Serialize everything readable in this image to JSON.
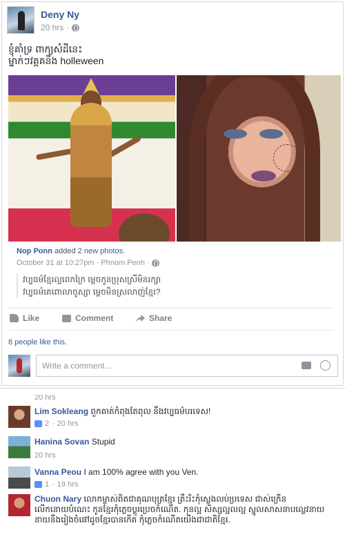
{
  "post": {
    "author": "Deny Ny",
    "time": "20 hrs",
    "text_line1": "ខ្ញុំគាំទ្រ ពាក្យសំដីនេះ",
    "text_line2": "ម្នាក់ៗវគ្គគនឹង holleween"
  },
  "shared": {
    "who": "Nop Ponn",
    "action": "added",
    "count": "2 new photos.",
    "time": "October 31 at 10:27pm · Phnom Penh ·",
    "quote_line1": "វប្បធម៌ខ្មែរល្អពេកក្រៃ ម្ដេចកូនប្រុសស្រីមិនរក្សា",
    "quote_line2": "វប្បធម៌គេពោលាចូស្សា ម្ដេចមិនស្រលាញ់ខ្មែរ?"
  },
  "actions": {
    "like": "Like",
    "comment": "Comment",
    "share": "Share"
  },
  "likes_summary": "8 people like this.",
  "comment_placeholder": "Write a comment...",
  "cut_text": "20 hrs",
  "comments": [
    {
      "name": "Lim Sokleang",
      "text": "ពួកគាត់កំពុងតែពុល នឹងវប្បធម៌បរទេស!",
      "likes": "2",
      "time": "20 hrs"
    },
    {
      "name": "Hanina Sovan",
      "text": "Stupid",
      "likes": "",
      "time": "20 hrs"
    },
    {
      "name": "Vanna Peou",
      "text": "I am 100% agree with you Ven.",
      "likes": "1",
      "time": "19 hrs"
    },
    {
      "name": "Chuon Nary",
      "text": "លោកម្ចាស់ពិតជាគុណបុត្រខ្មែរ ត្រឹះរិះកុំស្លេងលប់ប្រទេស ជាស់ក្រើនលើកនោយបំណេះ កូនខ្មែរកុំភ្លេចប្ដូរប្រេចកំណើត. កុនល្អ សិស្សល្អលល្អ ស្នូលសាសនាបល្លេវនាយនាយនឹងរៀងចំផៅដូចខ្មែរបានកេីត កុំភ្លេចកំណើតយើងជាជាតិខ្មែរ.",
      "likes": "",
      "time": ""
    }
  ]
}
